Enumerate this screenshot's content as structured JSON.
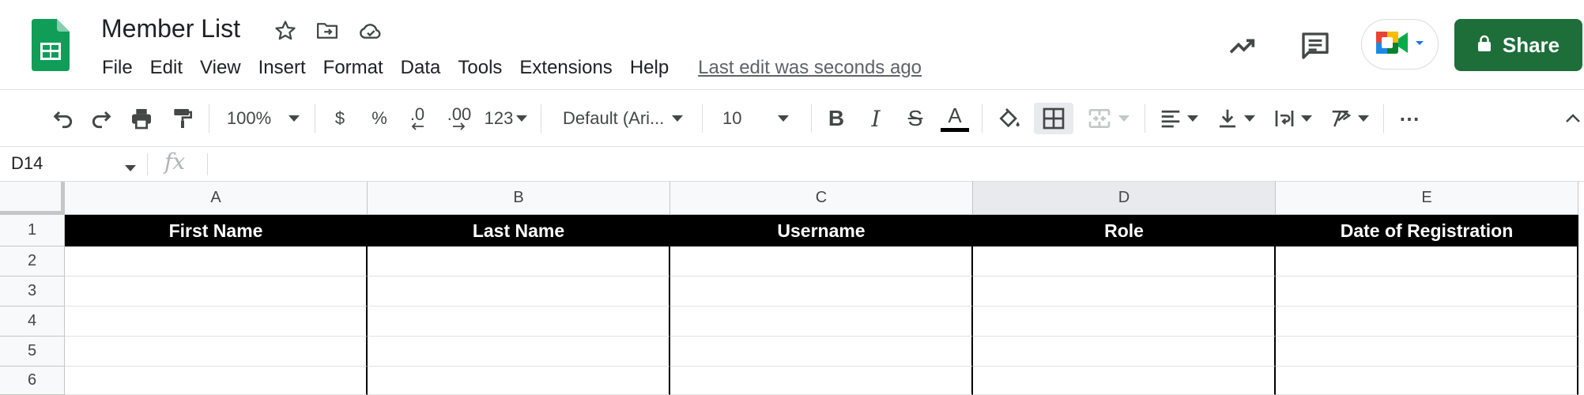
{
  "app": {
    "title": "Member List",
    "last_edit": "Last edit was seconds ago",
    "share_label": "Share"
  },
  "menu": [
    "File",
    "Edit",
    "View",
    "Insert",
    "Format",
    "Data",
    "Tools",
    "Extensions",
    "Help"
  ],
  "toolbar": {
    "zoom": "100%",
    "currency": "$",
    "percent": "%",
    "decrease_decimal": ".0",
    "increase_decimal": ".00",
    "number_format": "123",
    "font_family": "Default (Ari...",
    "font_size": "10",
    "bold": "B",
    "italic": "I",
    "strikethrough": "S",
    "text_color": "A",
    "text_color_value": "#000000",
    "more": "⋯"
  },
  "formula_bar": {
    "cell_ref": "D14",
    "fx": "fx",
    "content": ""
  },
  "sheet": {
    "columns": [
      "A",
      "B",
      "C",
      "D",
      "E"
    ],
    "selected_column": "D",
    "rows": [
      "1",
      "2",
      "3",
      "4",
      "5",
      "6"
    ],
    "header_row": [
      "First Name",
      "Last Name",
      "Username",
      "Role",
      "Date of Registration"
    ]
  },
  "colors": {
    "share_button": "#1e6e3a",
    "logo_green": "#0f9d58",
    "header_fill": "#000000",
    "header_text": "#ffffff"
  }
}
